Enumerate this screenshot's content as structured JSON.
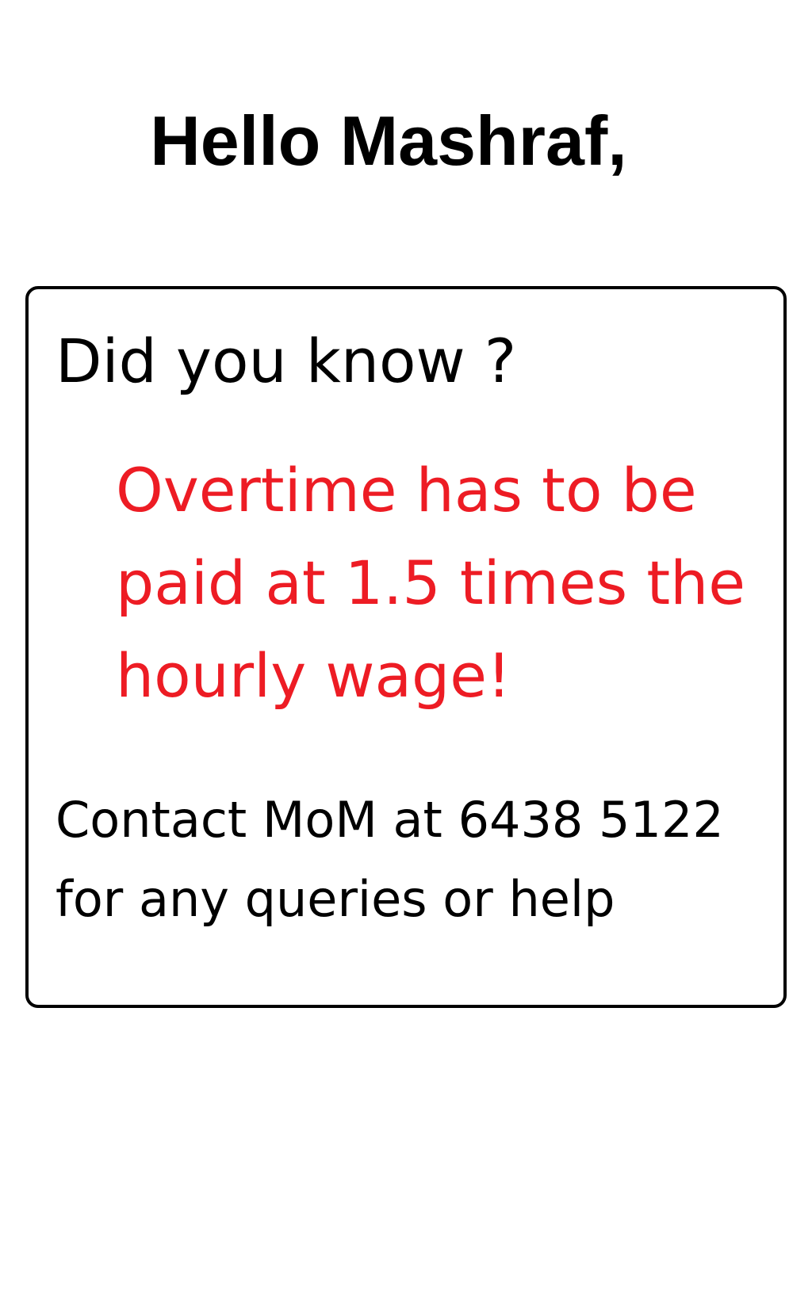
{
  "greeting": "Hello Mashraf,",
  "card": {
    "heading": "Did you know ?",
    "fact_lines": [
      "Overtime has to be",
      "paid at 1.5 times the",
      "hourly wage!"
    ],
    "contact_lines": [
      "Contact MoM at 6438 5122",
      "for any queries or help"
    ]
  },
  "colors": {
    "fact": "#ed1c24",
    "text": "#000000",
    "background": "#ffffff"
  }
}
